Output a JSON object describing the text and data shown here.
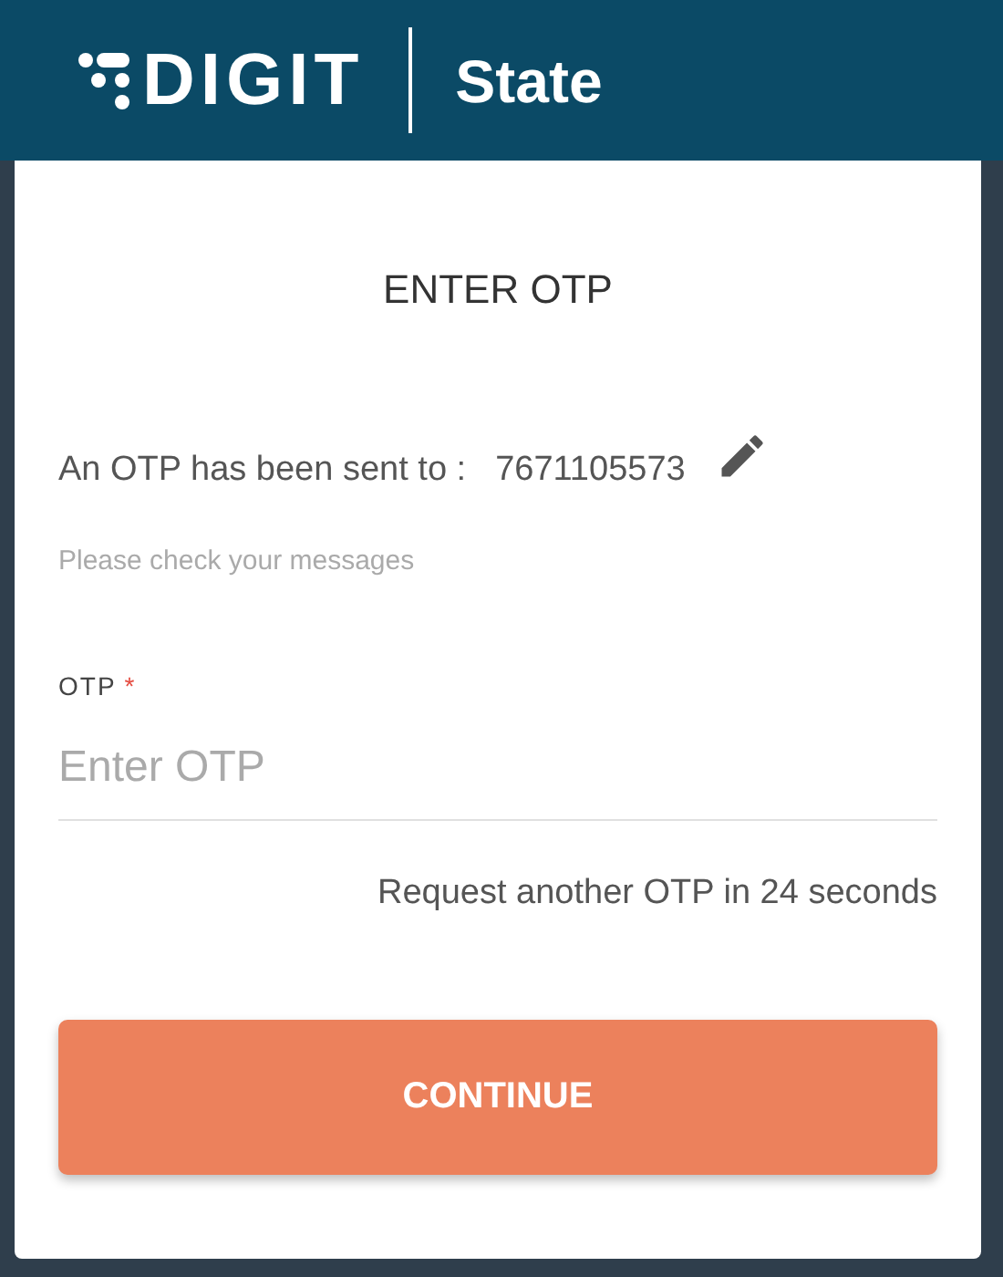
{
  "header": {
    "logo": "DIGIT",
    "subtitle": "State"
  },
  "card": {
    "title": "ENTER OTP",
    "message": "An OTP has been sent to :",
    "phone": "7671105573",
    "hint": "Please check your messages",
    "field": {
      "label": "OTP",
      "required_mark": "*",
      "placeholder": "Enter OTP"
    },
    "timer": "Request another OTP in 24 seconds",
    "button": "CONTINUE"
  }
}
